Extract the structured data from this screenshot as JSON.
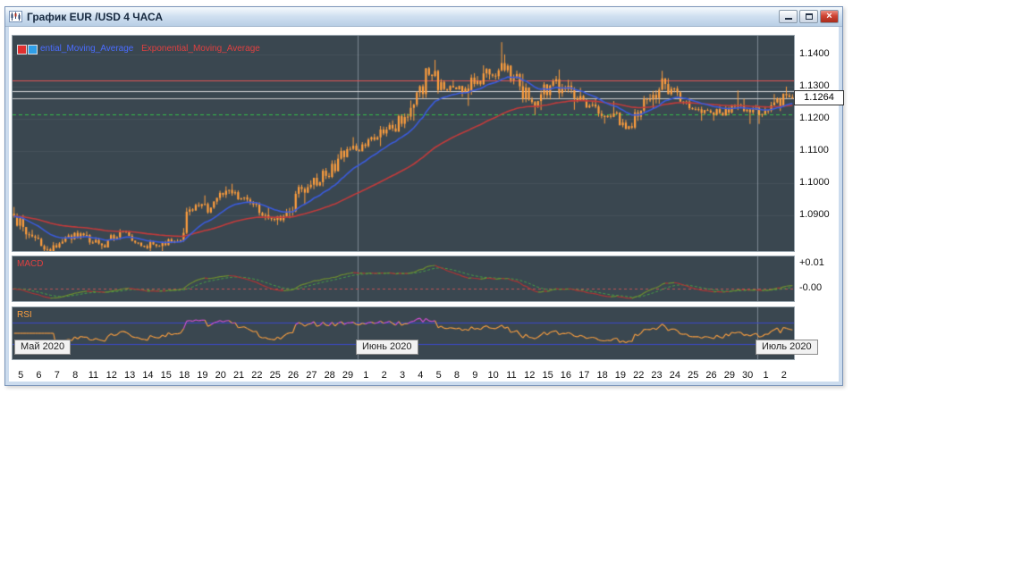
{
  "window": {
    "title": "График EUR /USD  4 ЧАСА"
  },
  "chart": {
    "legend": {
      "ma_fast": "ential_Moving_Average",
      "ma_slow": "Exponential_Moving_Average"
    },
    "price_axis": [
      "1.1400",
      "1.1300",
      "1.1200",
      "1.1100",
      "1.1000",
      "1.0900"
    ],
    "current_price": "1.1264",
    "levels": [
      {
        "price": 1.132,
        "color": "#e05555",
        "style": "solid"
      },
      {
        "price": 1.1285,
        "color": "#dcdcdc",
        "style": "solid"
      },
      {
        "price": 1.1264,
        "color": "#c8c8c8",
        "style": "solid"
      },
      {
        "price": 1.1215,
        "color": "#35c04a",
        "style": "dashed"
      }
    ],
    "macd": {
      "label": "MACD",
      "axis": [
        "+0.01",
        "-0.00"
      ]
    },
    "rsi": {
      "label": "RSI"
    },
    "months": [
      "Май 2020",
      "Июнь 2020",
      "Июль 2020"
    ]
  },
  "chart_data": {
    "type": "candlestick",
    "symbol": "EUR/USD",
    "timeframe": "4 часа",
    "price_range": [
      1.0789,
      1.1458
    ],
    "month_start_day_index": [
      19,
      41
    ],
    "indicators": [
      "Exponential Moving Average fast (blue)",
      "Exponential Moving Average slow (red)",
      "MACD",
      "RSI"
    ],
    "colors": {
      "panel_bg": "#3a4750",
      "candle": "#ff9e3d",
      "ema_fast": "#3a5bdc",
      "ema_slow": "#c23b3b",
      "macd_up": "#6f8f2f",
      "macd_down": "#b03434",
      "rsi": "#ffa13f",
      "rsi_hot": "#d84fd8",
      "level_blue": "#3a49c9",
      "grid": "rgba(190,200,212,0.5)"
    },
    "days": [
      {
        "label": "5",
        "o": 1.0905,
        "h": 1.0926,
        "l": 1.0826,
        "c": 1.084
      },
      {
        "label": "6",
        "o": 1.084,
        "h": 1.0855,
        "l": 1.0782,
        "c": 1.0795
      },
      {
        "label": "7",
        "o": 1.0795,
        "h": 1.0835,
        "l": 1.0766,
        "c": 1.0832
      },
      {
        "label": "8",
        "o": 1.0832,
        "h": 1.0853,
        "l": 1.0813,
        "c": 1.0838
      },
      {
        "label": "11",
        "o": 1.0838,
        "h": 1.085,
        "l": 1.0795,
        "c": 1.0807
      },
      {
        "label": "12",
        "o": 1.0807,
        "h": 1.0857,
        "l": 1.08,
        "c": 1.0848
      },
      {
        "label": "13",
        "o": 1.0848,
        "h": 1.0852,
        "l": 1.081,
        "c": 1.0815
      },
      {
        "label": "14",
        "o": 1.0815,
        "h": 1.0824,
        "l": 1.0775,
        "c": 1.0805
      },
      {
        "label": "15",
        "o": 1.0805,
        "h": 1.083,
        "l": 1.0789,
        "c": 1.082
      },
      {
        "label": "18",
        "o": 1.082,
        "h": 1.0927,
        "l": 1.0818,
        "c": 1.0915
      },
      {
        "label": "19",
        "o": 1.0915,
        "h": 1.0962,
        "l": 1.0905,
        "c": 1.0924
      },
      {
        "label": "20",
        "o": 1.0924,
        "h": 1.099,
        "l": 1.092,
        "c": 1.0979
      },
      {
        "label": "21",
        "o": 1.0979,
        "h": 1.0998,
        "l": 1.094,
        "c": 1.0949
      },
      {
        "label": "22",
        "o": 1.0949,
        "h": 1.0955,
        "l": 1.0885,
        "c": 1.0901
      },
      {
        "label": "25",
        "o": 1.0901,
        "h": 1.0925,
        "l": 1.087,
        "c": 1.0897
      },
      {
        "label": "26",
        "o": 1.0897,
        "h": 1.0995,
        "l": 1.0891,
        "c": 1.0982
      },
      {
        "label": "27",
        "o": 1.0982,
        "h": 1.103,
        "l": 1.0934,
        "c": 1.1003
      },
      {
        "label": "28",
        "o": 1.1003,
        "h": 1.109,
        "l": 1.099,
        "c": 1.1076
      },
      {
        "label": "29",
        "o": 1.1076,
        "h": 1.1143,
        "l": 1.1066,
        "c": 1.1102
      },
      {
        "label": "1",
        "o": 1.1102,
        "h": 1.1153,
        "l": 1.1099,
        "c": 1.1135
      },
      {
        "label": "2",
        "o": 1.1135,
        "h": 1.1195,
        "l": 1.1115,
        "c": 1.117
      },
      {
        "label": "3",
        "o": 1.117,
        "h": 1.1257,
        "l": 1.116,
        "c": 1.1234
      },
      {
        "label": "4",
        "o": 1.1234,
        "h": 1.1361,
        "l": 1.1194,
        "c": 1.1337
      },
      {
        "label": "5",
        "o": 1.1337,
        "h": 1.1383,
        "l": 1.1278,
        "c": 1.1289
      },
      {
        "label": "8",
        "o": 1.1289,
        "h": 1.132,
        "l": 1.1268,
        "c": 1.1294
      },
      {
        "label": "9",
        "o": 1.1294,
        "h": 1.1366,
        "l": 1.124,
        "c": 1.1341
      },
      {
        "label": "10",
        "o": 1.1341,
        "h": 1.1438,
        "l": 1.1322,
        "c": 1.1373
      },
      {
        "label": "11",
        "o": 1.1373,
        "h": 1.14,
        "l": 1.1288,
        "c": 1.1301
      },
      {
        "label": "12",
        "o": 1.1301,
        "h": 1.134,
        "l": 1.1212,
        "c": 1.1255
      },
      {
        "label": "15",
        "o": 1.1255,
        "h": 1.1333,
        "l": 1.1227,
        "c": 1.1323
      },
      {
        "label": "16",
        "o": 1.1323,
        "h": 1.1353,
        "l": 1.1228,
        "c": 1.1264
      },
      {
        "label": "17",
        "o": 1.1264,
        "h": 1.1296,
        "l": 1.1233,
        "c": 1.1244
      },
      {
        "label": "18",
        "o": 1.1244,
        "h": 1.1262,
        "l": 1.1185,
        "c": 1.1206
      },
      {
        "label": "19",
        "o": 1.1206,
        "h": 1.1255,
        "l": 1.1168,
        "c": 1.1177
      },
      {
        "label": "22",
        "o": 1.1177,
        "h": 1.1271,
        "l": 1.1168,
        "c": 1.126
      },
      {
        "label": "23",
        "o": 1.126,
        "h": 1.1349,
        "l": 1.1232,
        "c": 1.1308
      },
      {
        "label": "24",
        "o": 1.1308,
        "h": 1.1326,
        "l": 1.1245,
        "c": 1.1251
      },
      {
        "label": "25",
        "o": 1.1251,
        "h": 1.1265,
        "l": 1.1194,
        "c": 1.1218
      },
      {
        "label": "26",
        "o": 1.1218,
        "h": 1.124,
        "l": 1.1194,
        "c": 1.1218
      },
      {
        "label": "29",
        "o": 1.1218,
        "h": 1.1288,
        "l": 1.121,
        "c": 1.1243
      },
      {
        "label": "30",
        "o": 1.1243,
        "h": 1.1262,
        "l": 1.1184,
        "c": 1.1234
      },
      {
        "label": "1",
        "o": 1.1234,
        "h": 1.1277,
        "l": 1.1184,
        "c": 1.1251
      },
      {
        "label": "2",
        "o": 1.1251,
        "h": 1.13,
        "l": 1.1224,
        "c": 1.1264
      }
    ]
  }
}
